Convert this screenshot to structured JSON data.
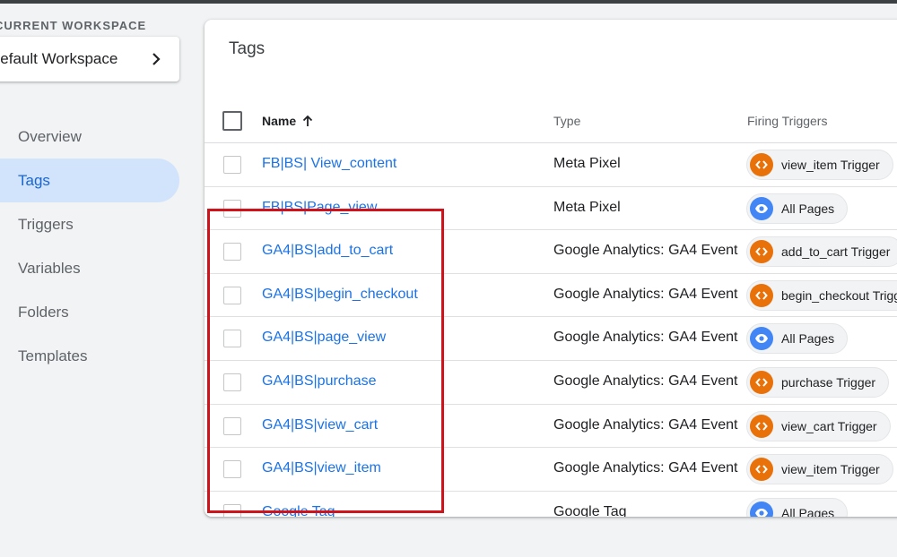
{
  "sidebar": {
    "workspace_heading": "CURRENT WORKSPACE",
    "workspace_name": "Default Workspace",
    "nav": [
      {
        "label": "Overview",
        "active": false
      },
      {
        "label": "Tags",
        "active": true
      },
      {
        "label": "Triggers",
        "active": false
      },
      {
        "label": "Variables",
        "active": false
      },
      {
        "label": "Folders",
        "active": false
      },
      {
        "label": "Templates",
        "active": false
      }
    ]
  },
  "main": {
    "title": "Tags",
    "columns": {
      "name": "Name",
      "type": "Type",
      "triggers": "Firing Triggers"
    },
    "rows": [
      {
        "name": "FB|BS| View_content",
        "type": "Meta Pixel",
        "trigger": "view_item Trigger",
        "trigger_icon": "custom-event-icon"
      },
      {
        "name": "FB|BS|Page_view",
        "type": "Meta Pixel",
        "trigger": "All Pages",
        "trigger_icon": "eye-icon"
      },
      {
        "name": "GA4|BS|add_to_cart",
        "type": "Google Analytics: GA4 Event",
        "trigger": "add_to_cart Trigger",
        "trigger_icon": "custom-event-icon"
      },
      {
        "name": "GA4|BS|begin_checkout",
        "type": "Google Analytics: GA4 Event",
        "trigger": "begin_checkout Trigger",
        "trigger_icon": "custom-event-icon"
      },
      {
        "name": "GA4|BS|page_view",
        "type": "Google Analytics: GA4 Event",
        "trigger": "All Pages",
        "trigger_icon": "eye-icon"
      },
      {
        "name": "GA4|BS|purchase",
        "type": "Google Analytics: GA4 Event",
        "trigger": "purchase Trigger",
        "trigger_icon": "custom-event-icon"
      },
      {
        "name": "GA4|BS|view_cart",
        "type": "Google Analytics: GA4 Event",
        "trigger": "view_cart Trigger",
        "trigger_icon": "custom-event-icon"
      },
      {
        "name": "GA4|BS|view_item",
        "type": "Google Analytics: GA4 Event",
        "trigger": "view_item Trigger",
        "trigger_icon": "custom-event-icon"
      },
      {
        "name": "Google Tag",
        "type": "Google Tag",
        "trigger": "All Pages",
        "trigger_icon": "eye-icon"
      }
    ]
  },
  "colors": {
    "accent": "#1a73e8",
    "active_nav_bg": "#d2e3fc",
    "custom_event_orange": "#e8710a",
    "page_view_blue": "#4285f4",
    "highlight_red": "#d0121b"
  }
}
